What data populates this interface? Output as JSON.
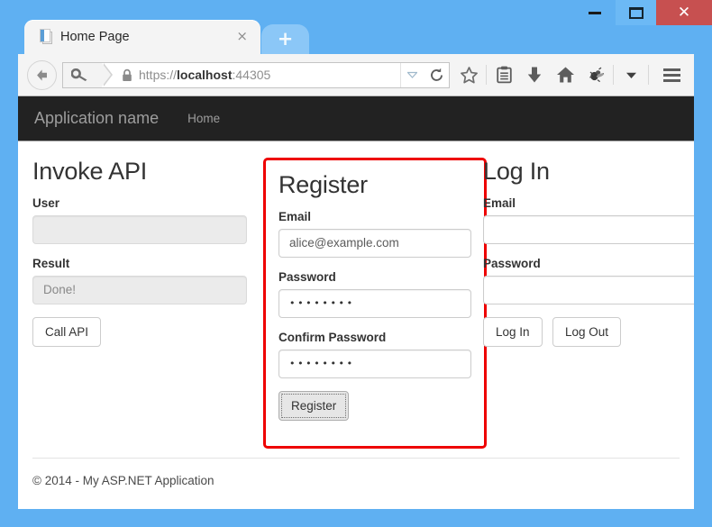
{
  "window": {
    "minimize_label": "—",
    "maximize_label": "❐",
    "close_label": "✕"
  },
  "browser": {
    "tab": {
      "title": "Home Page",
      "favicon": "page-favicon",
      "close_label": "×"
    },
    "newtab_label": "+",
    "toolbar": {
      "back_icon": "back-arrow-icon",
      "identity_icon": "key-icon",
      "lock_icon": "padlock-icon",
      "url_scheme": "https://",
      "url_host": "localhost",
      "url_port": ":44305",
      "url_dropdown_icon": "chevron-down-icon",
      "reload_icon": "reload-icon",
      "bookmark_icon": "star-icon",
      "reader_icon": "reading-list-icon",
      "download_icon": "download-arrow-icon",
      "home_icon": "home-icon",
      "debug_icon": "bug-icon",
      "debug_dropdown_icon": "caret-down-icon",
      "menu_icon": "hamburger-menu-icon"
    }
  },
  "site": {
    "navbar": {
      "brand": "Application name",
      "links": [
        {
          "label": "Home"
        }
      ]
    },
    "invoke": {
      "heading": "Invoke API",
      "user_label": "User",
      "user_value": "",
      "result_label": "Result",
      "result_value": "Done!",
      "call_api_label": "Call API"
    },
    "register": {
      "heading": "Register",
      "email_label": "Email",
      "email_value": "alice@example.com",
      "password_label": "Password",
      "password_value": "••••••••",
      "confirm_label": "Confirm Password",
      "confirm_value": "••••••••",
      "submit_label": "Register",
      "highlight_color": "#ee0000"
    },
    "login": {
      "heading": "Log In",
      "email_label": "Email",
      "email_value": "",
      "password_label": "Password",
      "password_value": "",
      "login_label": "Log In",
      "logout_label": "Log Out"
    },
    "footer": {
      "text": "© 2014 - My ASP.NET Application"
    }
  }
}
